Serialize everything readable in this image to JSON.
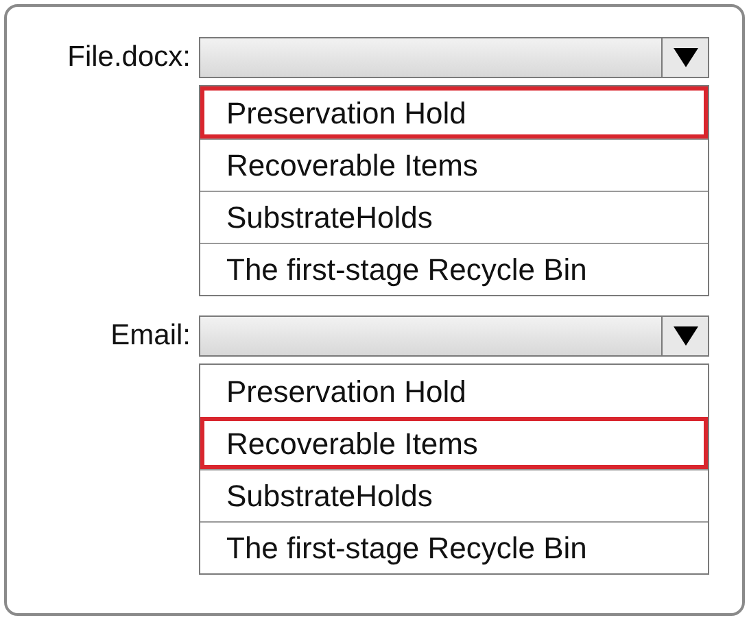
{
  "fields": [
    {
      "label": "File.docx:",
      "options": [
        {
          "text": "Preservation Hold",
          "selected": true
        },
        {
          "text": "Recoverable Items",
          "selected": false
        },
        {
          "text": "SubstrateHolds",
          "selected": false
        },
        {
          "text": "The first-stage Recycle Bin",
          "selected": false
        }
      ]
    },
    {
      "label": "Email:",
      "options": [
        {
          "text": "Preservation Hold",
          "selected": false
        },
        {
          "text": "Recoverable Items",
          "selected": true
        },
        {
          "text": "SubstrateHolds",
          "selected": false
        },
        {
          "text": "The first-stage Recycle Bin",
          "selected": false
        }
      ]
    }
  ]
}
